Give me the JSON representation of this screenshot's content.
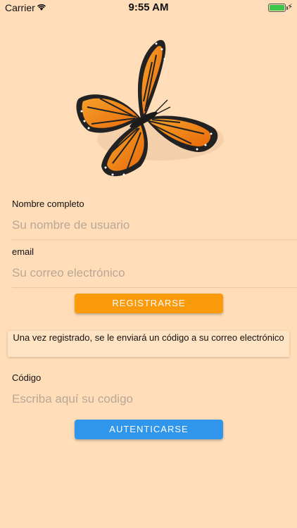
{
  "status_bar": {
    "carrier": "Carrier",
    "time": "9:55 AM",
    "wifi_icon": "wifi-icon",
    "battery_icon": "battery-icon",
    "charging_icon": "lightning-bolt-icon",
    "battery_color": "#3cc64a"
  },
  "logo": {
    "icon": "monarch-butterfly-icon"
  },
  "form": {
    "name_label": "Nombre completo",
    "name_placeholder": "Su nombre de usuario",
    "name_value": "",
    "email_label": "email",
    "email_placeholder": "Su correo electrónico",
    "email_value": "",
    "register_button": "REGISTRARSE",
    "info_text": "Una vez registrado, se le enviará un código a su correo electrónico",
    "code_label": "Código",
    "code_placeholder": "Escriba aquí su codigo",
    "code_value": "",
    "auth_button": "AUTENTICARSE"
  },
  "colors": {
    "background": "#ffddb8",
    "register_button": "#fb9a0a",
    "auth_button": "#2f96ec",
    "butterfly_orange": "#f07d10"
  }
}
